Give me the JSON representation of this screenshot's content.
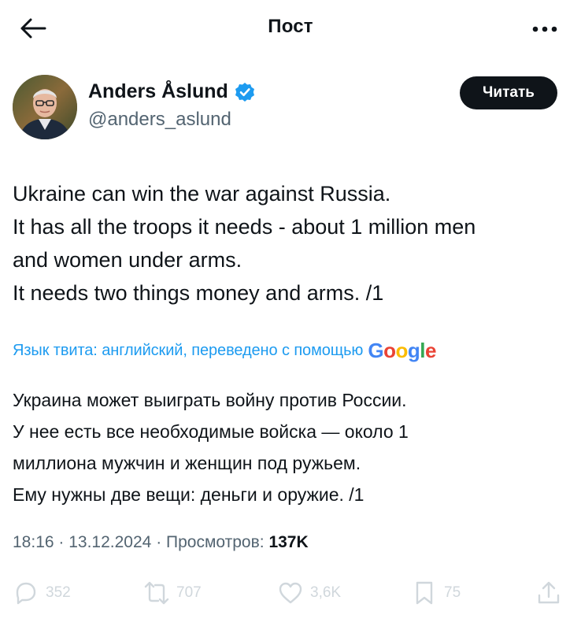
{
  "header": {
    "title": "Пост",
    "back_icon": "arrow-left-icon",
    "more_icon": "more-dots-icon"
  },
  "author": {
    "name": "Anders Åslund",
    "handle": "@anders_aslund",
    "verified_color": "#1d9bf0",
    "follow_label": "Читать"
  },
  "tweet": {
    "lines": [
      "Ukraine can win the war against Russia.",
      "It has all the troops it needs - about 1 million men",
      "and women under arms.",
      "It needs two things money and arms. /1"
    ]
  },
  "translation": {
    "label": "Язык твита: английский, переведено с помощью",
    "provider": "Google",
    "lines": [
      "Украина может выиграть войну против России.",
      "У нее есть все необходимые войска — около 1",
      "миллиона мужчин и женщин под ружьем.",
      "Ему нужны две вещи: деньги и оружие. /1"
    ]
  },
  "meta": {
    "time": "18:16",
    "date": "13.12.2024",
    "views_label": "Просмотров:",
    "views_count": "137K"
  },
  "actions": {
    "replies": "352",
    "reposts": "707",
    "likes": "3,6K",
    "bookmarks": "75"
  },
  "colors": {
    "accent": "#1d9bf0",
    "text": "#0f1419",
    "secondary": "#536471"
  }
}
